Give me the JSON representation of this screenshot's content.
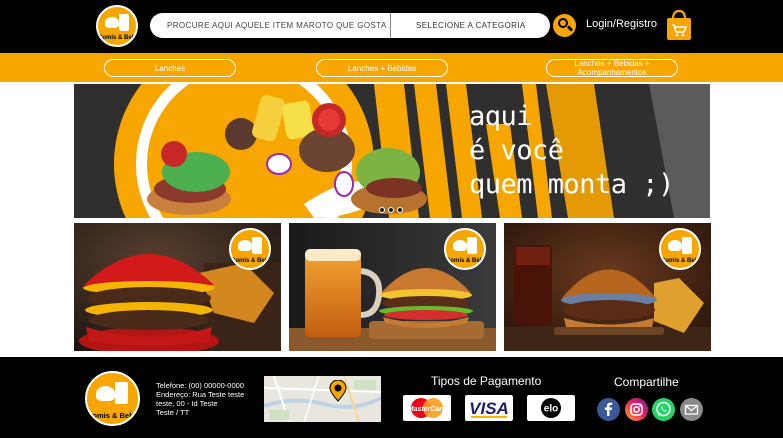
{
  "brand": {
    "logo_text": "Comis & Bebis",
    "colors": {
      "primary": "#f7a600",
      "dark": "#000000",
      "light": "#ffffff"
    }
  },
  "header": {
    "search": {
      "placeholder": "PROCURE AQUI AQUELE ITEM MAROTO QUE GOSTA . . ."
    },
    "category_select": {
      "selected": "SELECIONE A CATEGORIA"
    },
    "search_icon": "search-icon",
    "login_label": "Login/Registro",
    "cart_icon": "shopping-bag-icon"
  },
  "nav": {
    "items": [
      {
        "label": "Lanches"
      },
      {
        "label": "Lanches + Bebidas"
      },
      {
        "label": "Lanches + Bebidas + Acompanhamentos"
      }
    ]
  },
  "hero": {
    "text": "aqui\né você\nquem monta ;)",
    "slide_count": 3
  },
  "cards": [
    {
      "image": "red-bun-burger-with-fries"
    },
    {
      "image": "beer-mug-and-burger"
    },
    {
      "image": "burger-with-soda-and-fries"
    }
  ],
  "footer": {
    "contact": {
      "phone": "Telefone: (00) 00000-0000",
      "address": "Endereço: Rua Teste teste",
      "line3": "teste, 00 - Id Teste",
      "line4": "Teste / TT"
    },
    "map_icon": "map-pin-icon",
    "payment": {
      "title": "Tipos de Pagamento",
      "methods": [
        {
          "name": "MasterCard",
          "icon": "mastercard-icon"
        },
        {
          "name": "VISA",
          "icon": "visa-icon"
        },
        {
          "name": "elo",
          "icon": "elo-icon"
        }
      ]
    },
    "share": {
      "title": "Compartilhe",
      "networks": [
        {
          "icon": "facebook-icon",
          "color": "#3b5998"
        },
        {
          "icon": "instagram-icon",
          "color": "#e91e63"
        },
        {
          "icon": "whatsapp-icon",
          "color": "#25d366"
        },
        {
          "icon": "mail-icon",
          "color": "#8a8a8a"
        }
      ]
    }
  }
}
